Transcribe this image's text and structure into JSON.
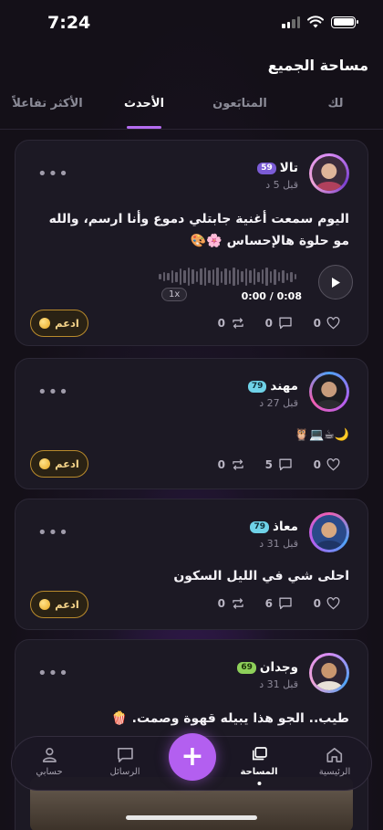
{
  "status": {
    "time": "7:24"
  },
  "header": {
    "title": "مساحة الجميع"
  },
  "tabs": [
    {
      "label": "لك",
      "active": false
    },
    {
      "label": "المتابَعون",
      "active": false
    },
    {
      "label": "الأحدث",
      "active": true
    },
    {
      "label": "الأكثر تفاعلاً",
      "active": false
    }
  ],
  "posts": [
    {
      "user": "تالا",
      "level": "59",
      "time": "قبل 5 د",
      "text": "اليوم سمعت أغنية جابتلي دموع وأنا ارسم، والله مو حلوة هالإحساس 🌸🎨",
      "audio": {
        "time": "0:00 / 0:08",
        "speed": "1x"
      },
      "likes": "0",
      "comments": "0",
      "reposts": "0",
      "support": "ادعم"
    },
    {
      "user": "مهند",
      "level": "79",
      "time": "قبل 27 د",
      "text": "🌙☕💻🦉",
      "likes": "0",
      "comments": "5",
      "reposts": "0",
      "support": "ادعم"
    },
    {
      "user": "معاذ",
      "level": "79",
      "time": "قبل 31 د",
      "text": "احلى شي في الليل السكون",
      "likes": "0",
      "comments": "6",
      "reposts": "0",
      "support": "ادعم"
    },
    {
      "user": "وجدان",
      "level": "69",
      "time": "قبل 31 د",
      "text": "طيب.. الجو هذا يبيله قهوة وصمت. 🍿"
    }
  ],
  "nav": {
    "home": "الرئيسية",
    "space": "المساحة",
    "messages": "الرسائل",
    "account": "حسابي",
    "add": "+"
  },
  "colors": {
    "accent": "#b35ff0",
    "support_gold": "#f5d48a"
  }
}
